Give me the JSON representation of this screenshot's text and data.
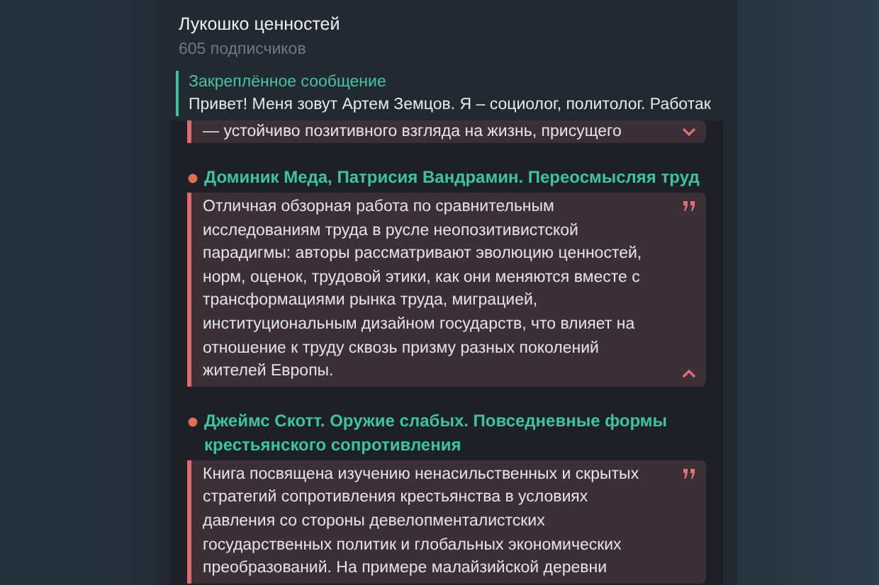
{
  "channel": {
    "title": "Лукошко ценностей",
    "subscribers": "605 подписчиков"
  },
  "pinned": {
    "label": "Закреплённое сообщение",
    "text": "Привет! Меня зовут Артем Земцов. Я – социолог, политолог. Работак"
  },
  "message": {
    "items": [
      {
        "kind": "quote",
        "expanded": false,
        "text": "— устойчиво позитивного взгляда на жизнь, присущего"
      },
      {
        "kind": "heading",
        "text": "Доминик Меда, Патрисия Вандрамин. Переосмысляя труд"
      },
      {
        "kind": "quote",
        "expanded": true,
        "text": "Отличная обзорная работа по сравнительным\nисследованиям труда в русле неопозитивистской\nпарадигмы: авторы рассматривают эволюцию ценностей,\nнорм, оценок, трудовой этики, как они меняются вместе с\nтрансформациями рынка труда, миграцией,\nинституциональным дизайном государств, что влияет на\nотношение к труду сквозь призму разных поколений\nжителей Европы."
      },
      {
        "kind": "heading",
        "text": "Джеймс Скотт. Оружие слабых. Повседневные формы\nкрестьянского сопротивления"
      },
      {
        "kind": "quote",
        "text": "Книга посвящена изучению ненасильственных и скрытых\nстратегий сопротивления крестьянства в условиях\nдавления со стороны девелопменталистских\nгосударственных политик и глобальных экономических\nпреобразований. На примере малайзийской деревни"
      }
    ]
  }
}
